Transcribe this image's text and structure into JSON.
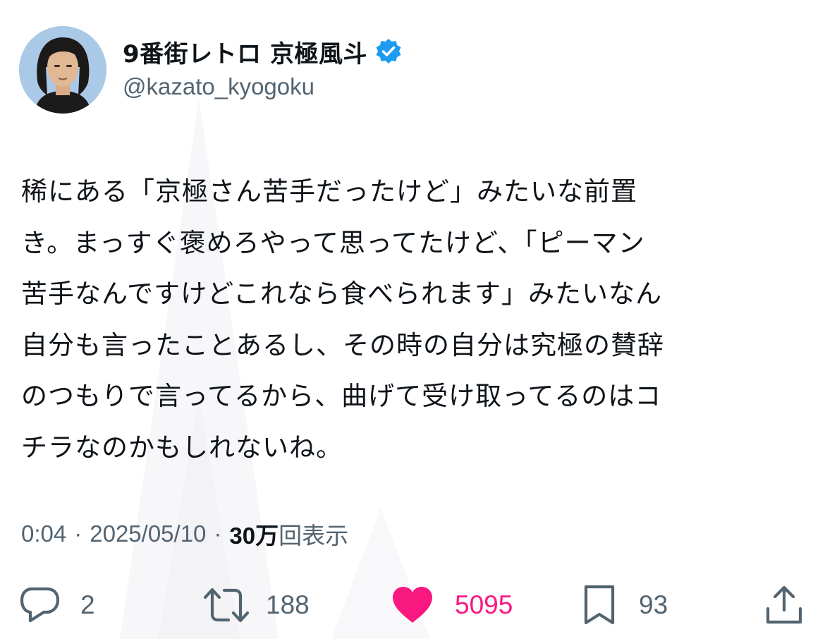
{
  "user": {
    "display_name": "9番街レトロ 京極風斗",
    "handle": "@kazato_kyogoku",
    "verified": true
  },
  "tweet": {
    "lines": [
      "稀にある「京極さん苦手だったけど」みたいな前置",
      "き。まっすぐ褒めろやって思ってたけど、「ピーマン",
      "苦手なんですけどこれなら食べられます」みたいなん",
      "自分も言ったことあるし、その時の自分は究極の賛辞",
      "のつもりで言ってるから、曲げて受け取ってるのはコ",
      "チラなのかもしれないね。"
    ]
  },
  "meta": {
    "time": "0:04",
    "separator": "·",
    "date": "2025/05/10",
    "views_count": "30万",
    "views_label": "回表示"
  },
  "actions": {
    "reply": {
      "icon": "reply-icon",
      "count": "2"
    },
    "repost": {
      "icon": "repost-icon",
      "count": "188"
    },
    "like": {
      "icon": "heart-icon",
      "count": "5095",
      "active": true
    },
    "bookmark": {
      "icon": "bookmark-icon",
      "count": "93"
    },
    "share": {
      "icon": "share-icon"
    }
  },
  "colors": {
    "text": "#0f1419",
    "secondary": "#536471",
    "verified": "#1d9bf0",
    "like": "#f91880",
    "background": "#ffffff"
  }
}
